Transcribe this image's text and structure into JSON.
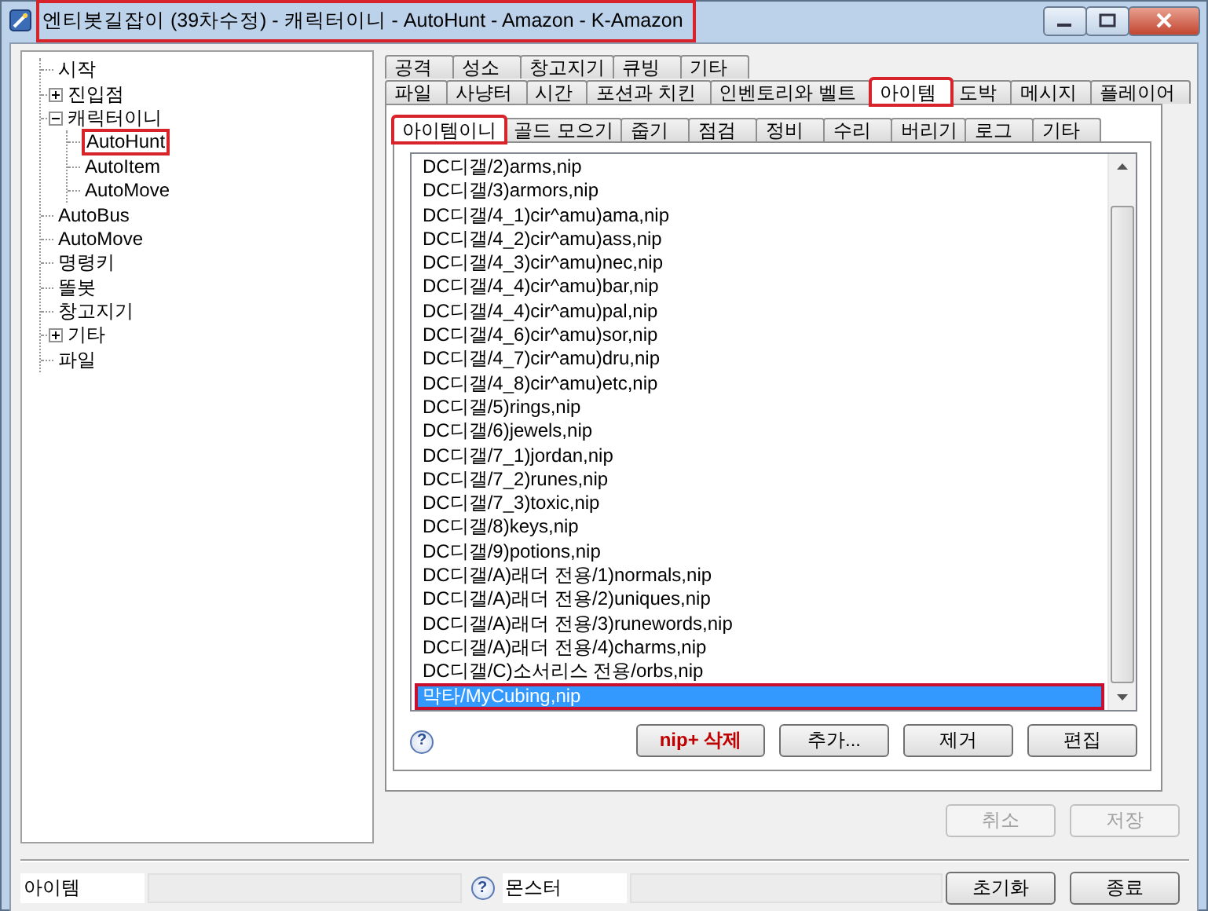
{
  "window": {
    "title": "엔티봇길잡이 (39차수정) - 캐릭터이니 - AutoHunt - Amazon - K-Amazon",
    "highlighted": true
  },
  "tree": [
    {
      "label": "시작"
    },
    {
      "label": "진입점",
      "expanded": false
    },
    {
      "label": "캐릭터이니",
      "expanded": true,
      "children": [
        {
          "label": "AutoHunt",
          "selected": true,
          "highlighted": true
        },
        {
          "label": "AutoItem",
          "selected": false
        },
        {
          "label": "AutoMove",
          "selected": false
        }
      ]
    },
    {
      "label": "AutoBus"
    },
    {
      "label": "AutoMove"
    },
    {
      "label": "명령키"
    },
    {
      "label": "똘봇"
    },
    {
      "label": "창고지기"
    },
    {
      "label": "기타",
      "expanded": false
    },
    {
      "label": "파일"
    }
  ],
  "tabs_back_row": [
    {
      "label": "공격",
      "selected": false
    },
    {
      "label": "성소",
      "selected": false
    },
    {
      "label": "창고지기",
      "selected": false
    },
    {
      "label": "큐빙",
      "selected": false
    },
    {
      "label": "기타",
      "selected": false
    }
  ],
  "tabs_front_row": [
    {
      "label": "파일",
      "selected": false
    },
    {
      "label": "사냥터",
      "selected": false
    },
    {
      "label": "시간",
      "selected": false
    },
    {
      "label": "포션과 치킨",
      "selected": false
    },
    {
      "label": "인벤토리와 벨트",
      "selected": false
    },
    {
      "label": "아이템",
      "selected": true,
      "highlighted": true
    },
    {
      "label": "도박",
      "selected": false
    },
    {
      "label": "메시지",
      "selected": false
    },
    {
      "label": "플레이어",
      "selected": false
    }
  ],
  "subtabs": [
    {
      "label": "아이템이니",
      "selected": true,
      "highlighted": true
    },
    {
      "label": "골드 모으기",
      "selected": false
    },
    {
      "label": "줍기",
      "selected": false
    },
    {
      "label": "점검",
      "selected": false
    },
    {
      "label": "정비",
      "selected": false
    },
    {
      "label": "수리",
      "selected": false
    },
    {
      "label": "버리기",
      "selected": false
    },
    {
      "label": "로그",
      "selected": false
    },
    {
      "label": "기타",
      "selected": false
    }
  ],
  "file_list": [
    {
      "label": "DC디갤/2)arms,nip",
      "selected": false
    },
    {
      "label": "DC디갤/3)armors,nip",
      "selected": false
    },
    {
      "label": "DC디갤/4_1)cir^amu)ama,nip",
      "selected": false
    },
    {
      "label": "DC디갤/4_2)cir^amu)ass,nip",
      "selected": false
    },
    {
      "label": "DC디갤/4_3)cir^amu)nec,nip",
      "selected": false
    },
    {
      "label": "DC디갤/4_4)cir^amu)bar,nip",
      "selected": false
    },
    {
      "label": "DC디갤/4_4)cir^amu)pal,nip",
      "selected": false
    },
    {
      "label": "DC디갤/4_6)cir^amu)sor,nip",
      "selected": false
    },
    {
      "label": "DC디갤/4_7)cir^amu)dru,nip",
      "selected": false
    },
    {
      "label": "DC디갤/4_8)cir^amu)etc,nip",
      "selected": false
    },
    {
      "label": "DC디갤/5)rings,nip",
      "selected": false
    },
    {
      "label": "DC디갤/6)jewels,nip",
      "selected": false
    },
    {
      "label": "DC디갤/7_1)jordan,nip",
      "selected": false
    },
    {
      "label": "DC디갤/7_2)runes,nip",
      "selected": false
    },
    {
      "label": "DC디갤/7_3)toxic,nip",
      "selected": false
    },
    {
      "label": "DC디갤/8)keys,nip",
      "selected": false
    },
    {
      "label": "DC디갤/9)potions,nip",
      "selected": false
    },
    {
      "label": "DC디갤/A)래더 전용/1)normals,nip",
      "selected": false
    },
    {
      "label": "DC디갤/A)래더 전용/2)uniques,nip",
      "selected": false
    },
    {
      "label": "DC디갤/A)래더 전용/3)runewords,nip",
      "selected": false
    },
    {
      "label": "DC디갤/A)래더 전용/4)charms,nip",
      "selected": false
    },
    {
      "label": "DC디갤/C)소서리스 전용/orbs,nip",
      "selected": false
    },
    {
      "label": "막타/MyCubing,nip",
      "selected": true,
      "highlighted": true
    }
  ],
  "list_help": "?",
  "list_buttons": [
    {
      "label": "nip+ 삭제",
      "kind": "danger"
    },
    {
      "label": "추가...",
      "kind": "normal"
    },
    {
      "label": "제거",
      "kind": "normal"
    },
    {
      "label": "편집",
      "kind": "normal"
    }
  ],
  "form_buttons": [
    {
      "label": "취소",
      "disabled": true
    },
    {
      "label": "저장",
      "disabled": true
    }
  ],
  "status_bar": {
    "item_label": "아이템",
    "help": "?",
    "monster_label": "몬스터",
    "buttons": [
      {
        "label": "초기화",
        "disabled": false
      },
      {
        "label": "종료",
        "disabled": false
      }
    ]
  }
}
